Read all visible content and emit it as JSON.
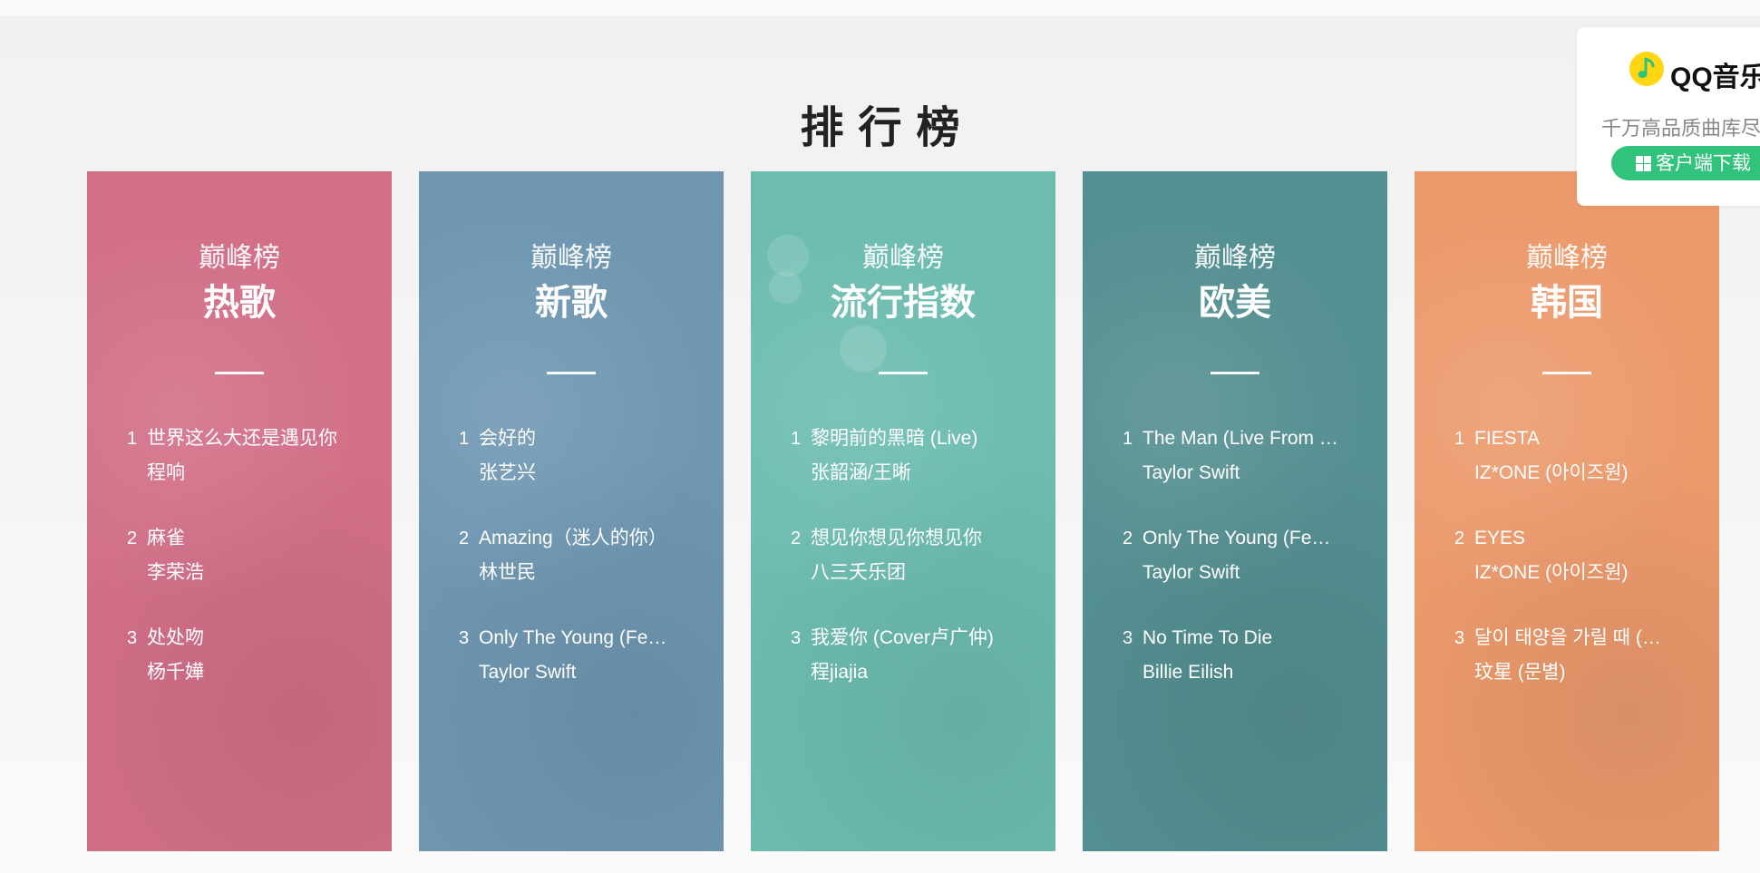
{
  "page": {
    "title": "排行榜"
  },
  "cards": [
    {
      "sub": "巅峰榜",
      "title": "热歌",
      "color": "#d26f88",
      "songs": [
        {
          "rank": "1",
          "name": "世界这么大还是遇见你",
          "artist": "程响"
        },
        {
          "rank": "2",
          "name": "麻雀",
          "artist": "李荣浩"
        },
        {
          "rank": "3",
          "name": "处处吻",
          "artist": "杨千嬅"
        }
      ]
    },
    {
      "sub": "巅峰榜",
      "title": "新歌",
      "color": "#6f97b2",
      "songs": [
        {
          "rank": "1",
          "name": "会好的",
          "artist": "张艺兴"
        },
        {
          "rank": "2",
          "name": "Amazing（迷人的你）",
          "artist": "林世民"
        },
        {
          "rank": "3",
          "name": "Only The Young (Fe…",
          "artist": "Taylor Swift"
        }
      ]
    },
    {
      "sub": "巅峰榜",
      "title": "流行指数",
      "color": "#6dbcb0",
      "songs": [
        {
          "rank": "1",
          "name": "黎明前的黑暗 (Live)",
          "artist": "张韶涵/王晰"
        },
        {
          "rank": "2",
          "name": "想见你想见你想见你",
          "artist": "八三夭乐团"
        },
        {
          "rank": "3",
          "name": "我爱你 (Cover卢广仲)",
          "artist": "程jiajia"
        }
      ]
    },
    {
      "sub": "巅峰榜",
      "title": "欧美",
      "color": "#548f91",
      "songs": [
        {
          "rank": "1",
          "name": "The Man (Live From …",
          "artist": "Taylor Swift"
        },
        {
          "rank": "2",
          "name": "Only The Young (Fe…",
          "artist": "Taylor Swift"
        },
        {
          "rank": "3",
          "name": "No Time To Die",
          "artist": "Billie Eilish"
        }
      ]
    },
    {
      "sub": "巅峰榜",
      "title": "韩国",
      "color": "#ec9a6c",
      "songs": [
        {
          "rank": "1",
          "name": "FIESTA",
          "artist": "IZ*ONE (아이즈원)"
        },
        {
          "rank": "2",
          "name": "EYES",
          "artist": "IZ*ONE (아이즈원)"
        },
        {
          "rank": "3",
          "name": "달이 태양을 가릴 때 (…",
          "artist": "玟星 (문별)"
        }
      ]
    }
  ],
  "promo": {
    "app_name": "QQ音乐",
    "slogan": "千万高品质曲库尽",
    "download_label": "客户端下载",
    "logo_icon": "qq-music-logo-icon",
    "download_icon": "windows-icon",
    "brand_color": "#31c27c",
    "logo_color": "#ffd60f"
  }
}
